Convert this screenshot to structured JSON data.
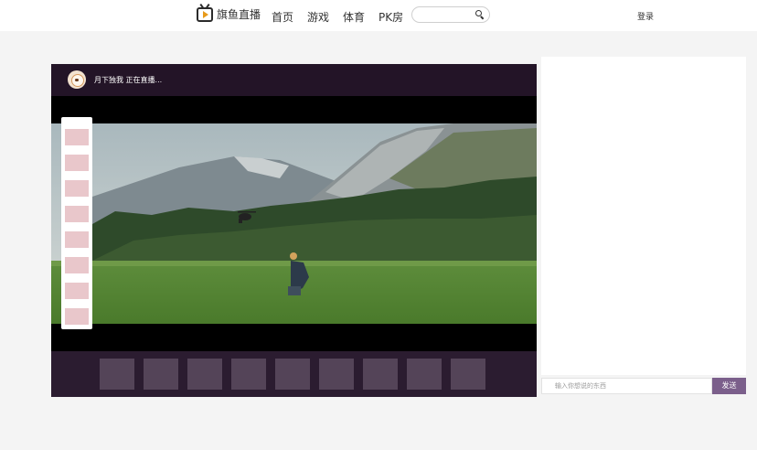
{
  "header": {
    "logo_text": "旗鱼直播",
    "nav": [
      "首页",
      "游戏",
      "体育",
      "PK房"
    ],
    "search_placeholder": "",
    "login_label": "登录"
  },
  "player": {
    "streamer_title": "月下独我 正在直播...",
    "gift_count": 8,
    "thumb_count": 9
  },
  "chat": {
    "input_placeholder": "输入你想说的东西",
    "send_label": "发送"
  },
  "colors": {
    "player_bar": "#231427",
    "thumb_bar": "#2b1c30",
    "thumb": "#544458",
    "gift": "#e9c7cb",
    "send_button": "#7b5f8b"
  }
}
